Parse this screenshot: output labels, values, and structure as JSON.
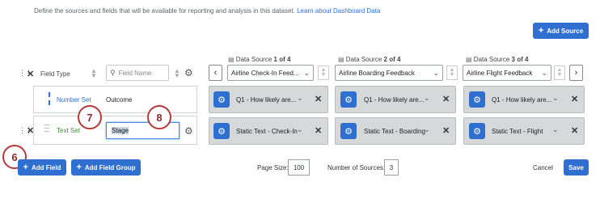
{
  "intro": {
    "text": "Define the sources and fields that will be available for reporting and analysis in this dataset.",
    "link": "Learn about Dashboard Data"
  },
  "header": {
    "add_source_label": "Add Source",
    "field_type_label": "Field Type",
    "field_name_placeholder": "Field Name",
    "data_sources": [
      {
        "prefix": "Data Source",
        "num": "1",
        "of": "of",
        "total": "4",
        "selected": "Airline Check-In Feed..."
      },
      {
        "prefix": "Data Source",
        "num": "2",
        "of": "of",
        "total": "4",
        "selected": "Airline Boarding Feedback"
      },
      {
        "prefix": "Data Source",
        "num": "3",
        "of": "of",
        "total": "4",
        "selected": "Airline Flight Feedback"
      }
    ]
  },
  "rows": [
    {
      "type": "Number Set",
      "name": "Outcome",
      "mappings": [
        "Q1 - How likely are...",
        "Q1 - How likely are...",
        "Q1 - How likely are..."
      ]
    },
    {
      "type": "Text Set",
      "name": "Stage",
      "mappings": [
        "Static Text - Check-In",
        "Static Text - Boarding",
        "Static Text - Flight"
      ]
    }
  ],
  "callouts": {
    "c6": "6",
    "c7": "7",
    "c8": "8"
  },
  "footer": {
    "add_field_label": "Add Field",
    "add_field_group_label": "Add Field Group",
    "page_size_label": "Page Size:",
    "page_size_value": "100",
    "num_sources_label": "Number of Sources:",
    "num_sources_value": "3",
    "cancel_label": "Cancel",
    "save_label": "Save"
  },
  "colors": {
    "accent": "#2f6fcf",
    "callout": "#b5383b",
    "number_set": "#2f6fcf",
    "text_set": "#3c8f2f"
  }
}
